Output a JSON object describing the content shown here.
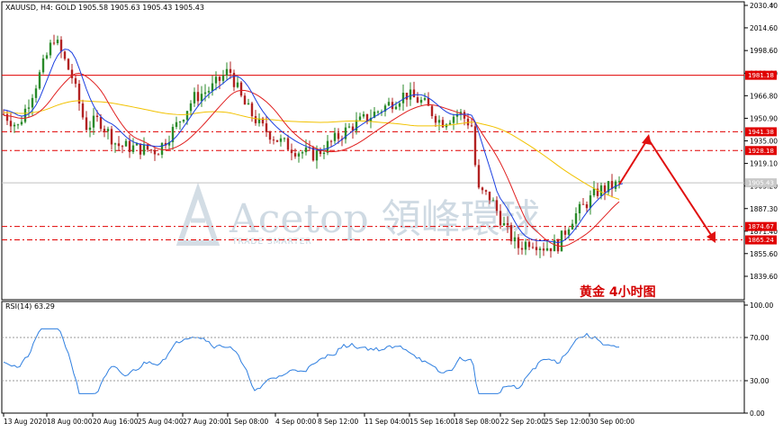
{
  "header": {
    "symbol_info": "XAUUSD, H4:  GOLD  1905.58 1905.63 1905.43 1905.43",
    "rsi_label": "RSI(14) 63.29"
  },
  "annotation": {
    "title": "黄金    4小时图"
  },
  "watermark": {
    "brand": "Acetop 領峰環球",
    "sub": "TRADE SMARTER"
  },
  "price_axis": {
    "labels": [
      "2030.40",
      "2014.60",
      "1998.60",
      "1982.60",
      "1966.80",
      "1950.90",
      "1935.00",
      "1919.10",
      "1903.20",
      "1887.30",
      "1871.40",
      "1855.60",
      "1839.60"
    ]
  },
  "price_levels": [
    {
      "label": "1981.18",
      "style": "solid"
    },
    {
      "label": "1941.38",
      "style": "dashed"
    },
    {
      "label": "1928.18",
      "style": "dashed"
    },
    {
      "label": "1874.67",
      "style": "dashed"
    },
    {
      "label": "1865.24",
      "style": "dashed"
    }
  ],
  "current_price": "1905.43",
  "rsi_axis": {
    "labels": [
      "100.00",
      "70.00",
      "30.00",
      "0.00"
    ]
  },
  "time_axis": {
    "labels": [
      "13 Aug 2020",
      "18 Aug 00:00",
      "20 Aug 16:00",
      "25 Aug 04:00",
      "27 Aug 20:00",
      "1 Sep 08:00",
      "4 Sep 00:00",
      "8 Sep 12:00",
      "11 Sep 04:00",
      "15 Sep 16:00",
      "18 Sep 08:00",
      "22 Sep 20:00",
      "25 Sep 12:00",
      "30 Sep 00:00"
    ]
  },
  "colors": {
    "level_line": "#e00000",
    "blue_ma": "#1b3fe0",
    "red_ma": "#e02020",
    "yellow_ma": "#f2c200",
    "candle_bull": "#2a8a2a",
    "candle_bear": "#b22222",
    "rsi_line": "#2f7fe0",
    "arrow": "#e01010"
  }
}
